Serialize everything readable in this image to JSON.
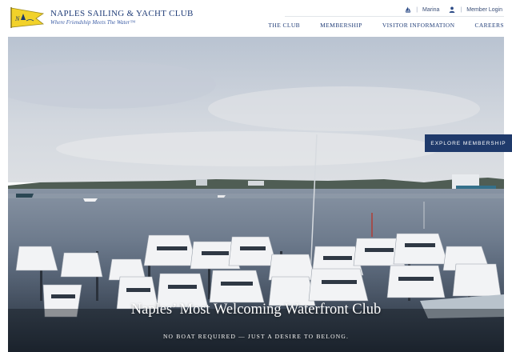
{
  "header": {
    "brand_name": "NAPLES SAILING & YACHT CLUB",
    "tagline": "Where Friendship Meets The Water™",
    "logo_icon": "club-burgee-flag-icon",
    "utility": {
      "separator": "|",
      "marina_label": "Marina",
      "marina_icon": "sailboat-icon",
      "login_label": "Member Login",
      "login_icon": "user-icon"
    },
    "nav": {
      "items": [
        "THE CLUB",
        "MEMBERSHIP",
        "VISITOR INFORMATION",
        "CAREERS"
      ]
    }
  },
  "hero": {
    "cta_label": "EXPLORE MEMBERSHIP",
    "title": "Naples’ Most Welcoming Waterfront Club",
    "subtitle": "NO BOAT REQUIRED — JUST A DESIRE TO BELONG."
  },
  "colors": {
    "brand_navy": "#1f3a6b",
    "logo_yellow": "#f2d22a",
    "sky": "#c9d1dc",
    "water": "#6f7d8f"
  }
}
